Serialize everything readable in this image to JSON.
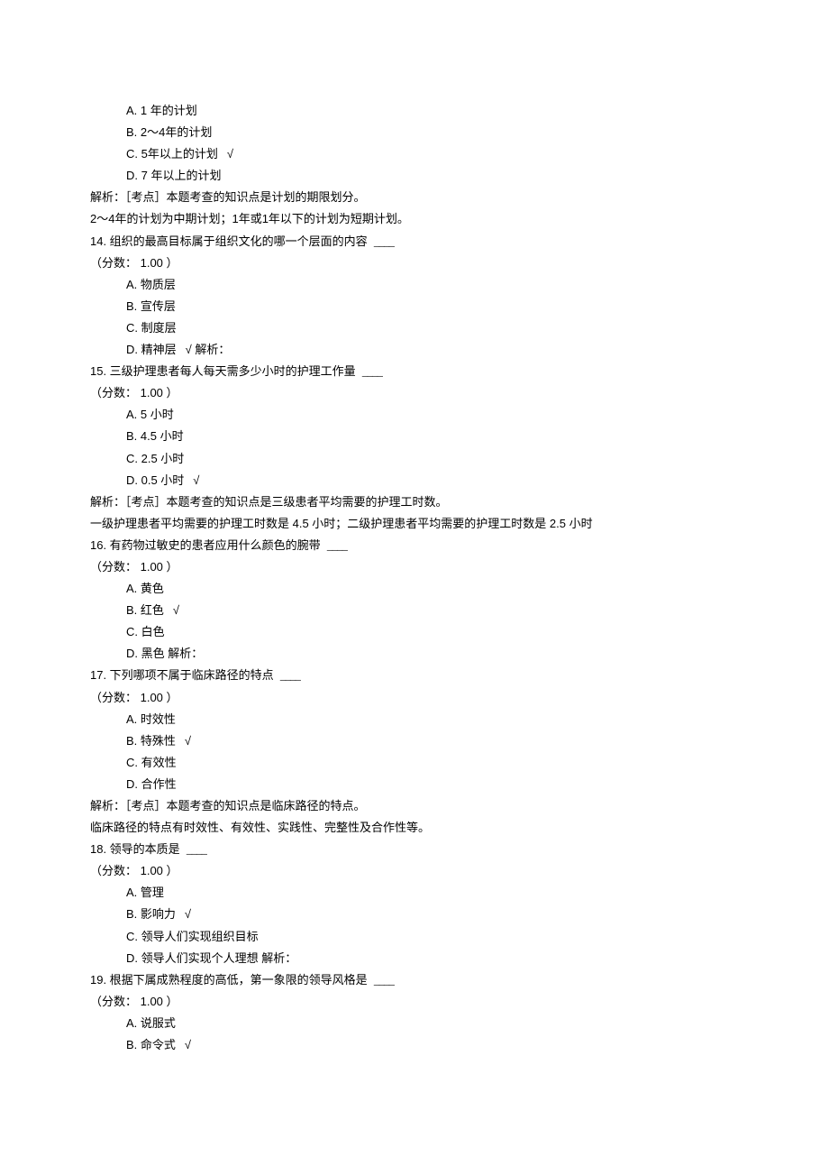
{
  "q13": {
    "opt_a": "A. 1 年的计划",
    "opt_b": "B. 2～4年的计划",
    "opt_c": "C. 5年以上的计划",
    "opt_d": "D. 7 年以上的计划",
    "check": "√",
    "analysis1": "解析：［考点］本题考查的知识点是计划的期限划分。",
    "analysis2": "2～4年的计划为中期计划；1年或1年以下的计划为短期计划。"
  },
  "q14": {
    "stem": "14. 组织的最高目标属于组织文化的哪一个层面的内容",
    "blank": "____",
    "score": "（分数： 1.00 ）",
    "opt_a": "A. 物质层",
    "opt_b": "B. 宣传层",
    "opt_c": "C. 制度层",
    "opt_d": "D. 精神层",
    "check": "√",
    "analysis_inline": "解析："
  },
  "q15": {
    "stem": "15. 三级护理患者每人每天需多少小时的护理工作量",
    "blank": "____",
    "score": "（分数： 1.00 ）",
    "opt_a": "A. 5 小时",
    "opt_b": "B. 4.5 小时",
    "opt_c": "C. 2.5 小时",
    "opt_d": "D. 0.5 小时",
    "check": "√",
    "analysis1": "解析：［考点］本题考查的知识点是三级患者平均需要的护理工时数。",
    "analysis2": "一级护理患者平均需要的护理工时数是 4.5 小时；二级护理患者平均需要的护理工时数是 2.5 小时"
  },
  "q16": {
    "stem": "16. 有药物过敏史的患者应用什么颜色的腕带",
    "blank": "____",
    "score": "（分数： 1.00 ）",
    "opt_a": "A. 黄色",
    "opt_b": "B. 红色",
    "opt_c": "C. 白色",
    "opt_d": "D. 黑色",
    "check": "√",
    "analysis_inline": "解析："
  },
  "q17": {
    "stem": "17. 下列哪项不属于临床路径的特点",
    "blank": "____",
    "score": "（分数： 1.00 ）",
    "opt_a": "A. 时效性",
    "opt_b": "B. 特殊性",
    "opt_c": "C. 有效性",
    "opt_d": "D. 合作性",
    "check": "√",
    "analysis1": "解析：［考点］本题考查的知识点是临床路径的特点。",
    "analysis2": "临床路径的特点有时效性、有效性、实践性、完整性及合作性等。"
  },
  "q18": {
    "stem": "18. 领导的本质是",
    "blank": "____",
    "score": "（分数： 1.00 ）",
    "opt_a": "A. 管理",
    "opt_b": "B. 影响力",
    "opt_c": "C. 领导人们实现组织目标",
    "opt_d": "D. 领导人们实现个人理想",
    "check": "√",
    "analysis_inline": "解析："
  },
  "q19": {
    "stem": "19. 根据下属成熟程度的高低，第一象限的领导风格是",
    "blank": "____",
    "score": "（分数： 1.00 ）",
    "opt_a": "A. 说服式",
    "opt_b": "B. 命令式",
    "check": "√"
  }
}
